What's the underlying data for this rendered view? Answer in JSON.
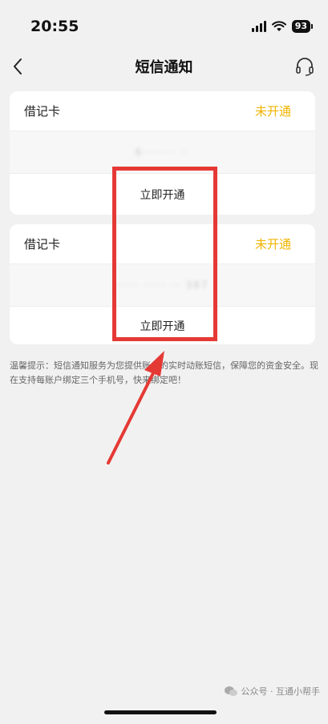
{
  "status_bar": {
    "time": "20:55",
    "battery": "93"
  },
  "nav": {
    "title": "短信通知"
  },
  "cards": [
    {
      "type": "借记卡",
      "status": "未开通",
      "number": "6·······  ··",
      "action": "立即开通"
    },
    {
      "type": "借记卡",
      "status": "未开通",
      "number": "·····  ·····  ·· 387",
      "action": "立即开通"
    }
  ],
  "tip": "温馨提示：短信通知服务为您提供账户的实时动账短信，保障您的资金安全。现在支持每账户绑定三个手机号，快来绑定吧！",
  "watermark": "公众号 · 互通小帮手",
  "colors": {
    "accent": "#f0b400",
    "highlight": "#e53935"
  }
}
